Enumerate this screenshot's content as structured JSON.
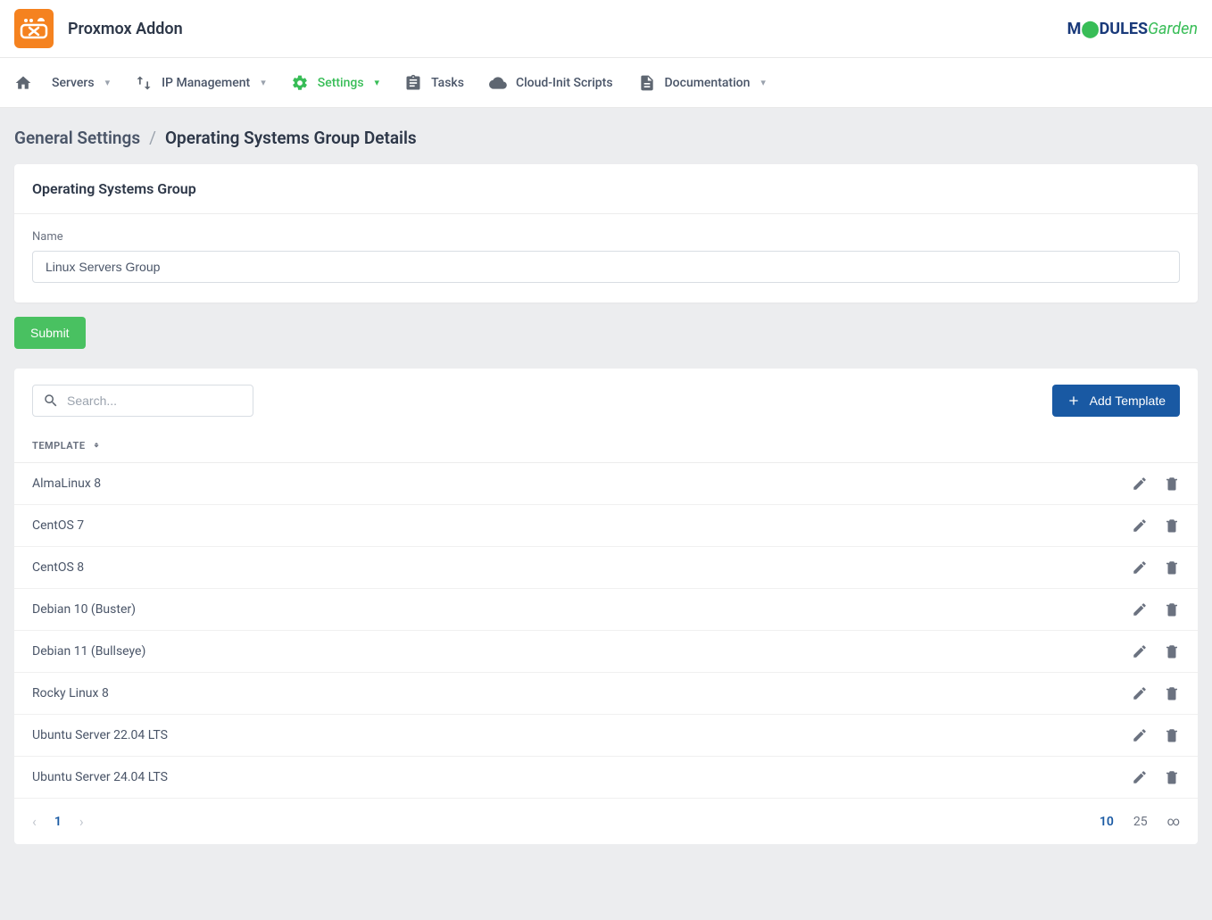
{
  "header": {
    "title": "Proxmox Addon",
    "brand_modules": "M",
    "brand_dules": "DULES",
    "brand_garden": "Garden"
  },
  "nav": {
    "servers": "Servers",
    "ip_management": "IP Management",
    "settings": "Settings",
    "tasks": "Tasks",
    "cloud_init": "Cloud-Init Scripts",
    "documentation": "Documentation"
  },
  "crumbs": {
    "parent": "General Settings",
    "current": "Operating Systems Group Details"
  },
  "form": {
    "card_title": "Operating Systems Group",
    "name_label": "Name",
    "name_value": "Linux Servers Group",
    "submit": "Submit"
  },
  "table": {
    "search_placeholder": "Search...",
    "add_template": "Add Template",
    "col_template": "TEMPLATE",
    "rows": [
      {
        "name": "AlmaLinux 8"
      },
      {
        "name": "CentOS 7"
      },
      {
        "name": "CentOS 8"
      },
      {
        "name": "Debian 10 (Buster)"
      },
      {
        "name": "Debian 11 (Bullseye)"
      },
      {
        "name": "Rocky Linux 8"
      },
      {
        "name": "Ubuntu Server 22.04 LTS"
      },
      {
        "name": "Ubuntu Server 24.04 LTS"
      }
    ],
    "page": "1",
    "sizes": {
      "s10": "10",
      "s25": "25",
      "inf": "∞"
    }
  }
}
